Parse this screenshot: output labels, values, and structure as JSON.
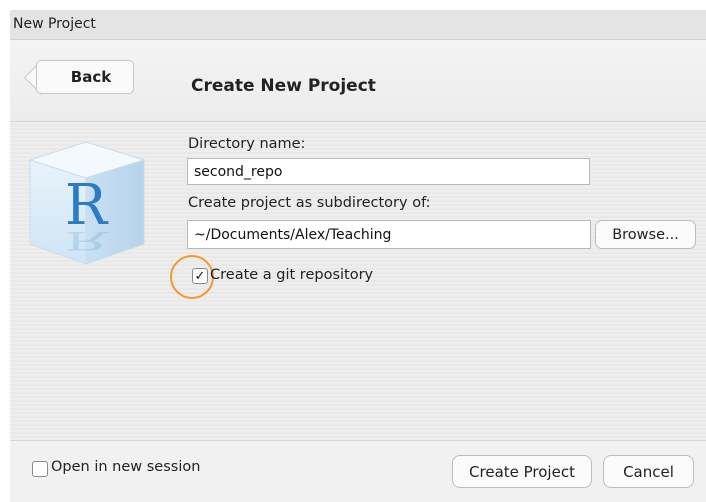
{
  "window": {
    "title": "New Project"
  },
  "header": {
    "back_label": "Back",
    "title": "Create New Project"
  },
  "form": {
    "directory_label": "Directory name:",
    "directory_value": "second_repo",
    "subdir_label": "Create project as subdirectory of:",
    "subdir_value": "~/Documents/Alex/Teaching",
    "browse_label": "Browse...",
    "git_label": "Create a git repository",
    "git_checked": true
  },
  "logo": {
    "letter": "R"
  },
  "footer": {
    "new_session_label": "Open in new session",
    "new_session_checked": false,
    "create_label": "Create Project",
    "cancel_label": "Cancel"
  },
  "colors": {
    "highlight_ring": "#f29a2e",
    "logo_letter": "#2a7dc4"
  },
  "icons": [
    "r-logo-icon",
    "check-icon"
  ]
}
